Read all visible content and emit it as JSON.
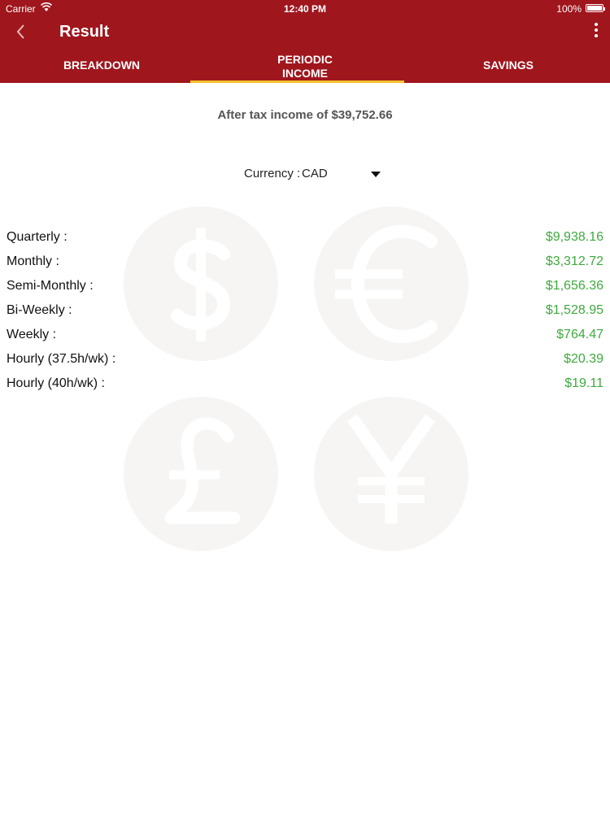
{
  "status_bar": {
    "carrier": "Carrier",
    "time": "12:40 PM",
    "battery": "100%"
  },
  "header": {
    "title": "Result",
    "background_color": "#a0161d",
    "icons": {
      "back": "chevron-left-icon",
      "more": "more-vertical-icon"
    }
  },
  "tabs": [
    {
      "label": "BREAKDOWN",
      "active": false
    },
    {
      "label": "PERIODIC\nINCOME",
      "active": true
    },
    {
      "label": "SAVINGS",
      "active": false
    }
  ],
  "tab_indicator_color": "#f4c12a",
  "summary": "After tax income of $39,752.66",
  "currency": {
    "label": "Currency :",
    "value": "CAD"
  },
  "value_color": "#3eaa3e",
  "background_icons": [
    "dollar-icon",
    "euro-icon",
    "pound-icon",
    "yen-icon"
  ],
  "rows": [
    {
      "label": "Quarterly :",
      "value": "$9,938.16"
    },
    {
      "label": "Monthly :",
      "value": "$3,312.72"
    },
    {
      "label": "Semi-Monthly :",
      "value": "$1,656.36"
    },
    {
      "label": "Bi-Weekly :",
      "value": "$1,528.95"
    },
    {
      "label": "Weekly :",
      "value": "$764.47"
    },
    {
      "label": "Hourly (37.5h/wk) :",
      "value": "$20.39"
    },
    {
      "label": "Hourly (40h/wk) :",
      "value": "$19.11"
    }
  ]
}
